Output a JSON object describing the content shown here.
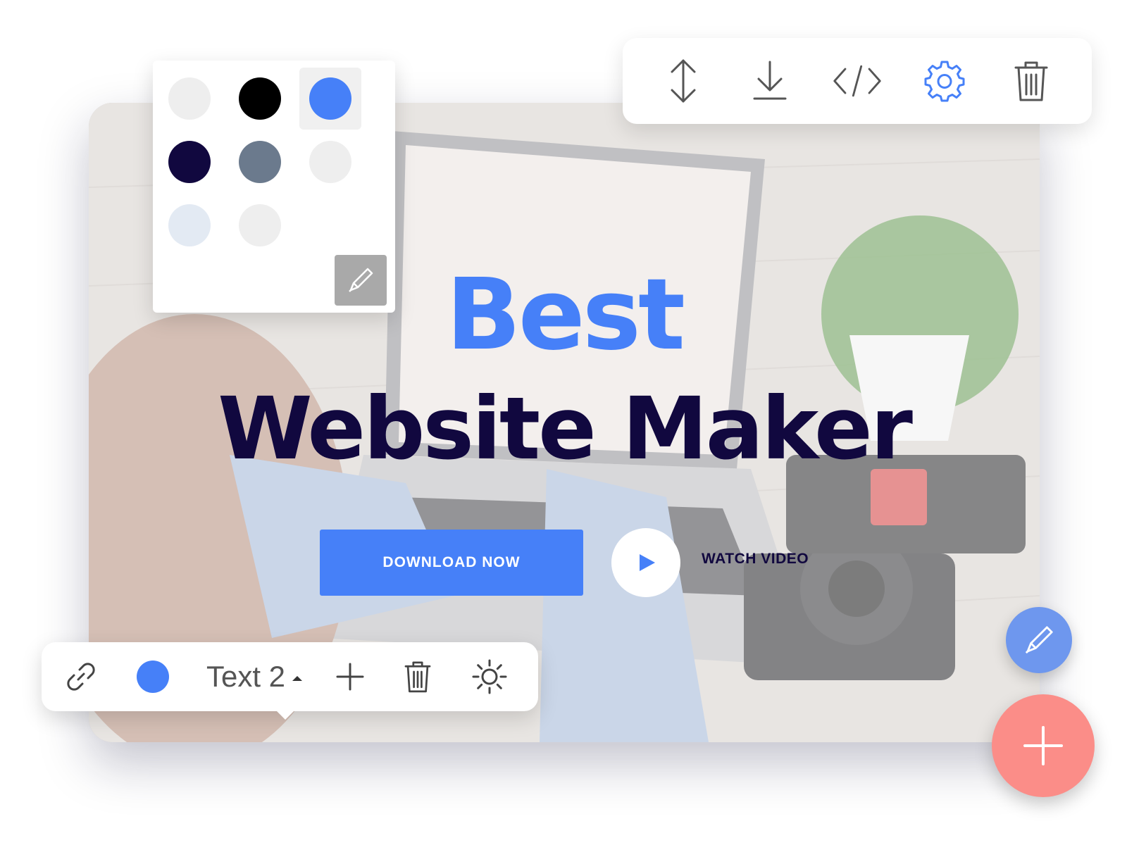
{
  "hero": {
    "title_line1": "Best",
    "title_line2": "Website Maker",
    "download_label": "DOWNLOAD NOW",
    "watch_label": "WATCH VIDEO",
    "accent": "#4680f8",
    "title_color": "#11083f"
  },
  "block_toolbar": {
    "items": [
      {
        "icon": "resize-vertical-icon"
      },
      {
        "icon": "download-icon"
      },
      {
        "icon": "code-icon"
      },
      {
        "icon": "gear-icon",
        "active": true
      },
      {
        "icon": "trash-icon"
      }
    ]
  },
  "color_picker": {
    "swatches": [
      "#eeeeee",
      "#000000",
      "#4680f8",
      "#11083f",
      "#6b7a8d",
      "#eeeeee",
      "#e3eaf3",
      "#eeeeee"
    ],
    "selected_index": 2,
    "edit_icon": "pencil-icon"
  },
  "text_toolbar": {
    "link_icon": "link-icon",
    "color": "#4680f8",
    "style_label": "Text 2",
    "add_icon": "plus-icon",
    "delete_icon": "trash-icon",
    "brightness_icon": "sun-icon"
  },
  "fab": {
    "edit_icon": "pencil-icon",
    "edit_color": "#6e97ee",
    "add_icon": "plus-icon",
    "add_color": "#fb8d88"
  }
}
